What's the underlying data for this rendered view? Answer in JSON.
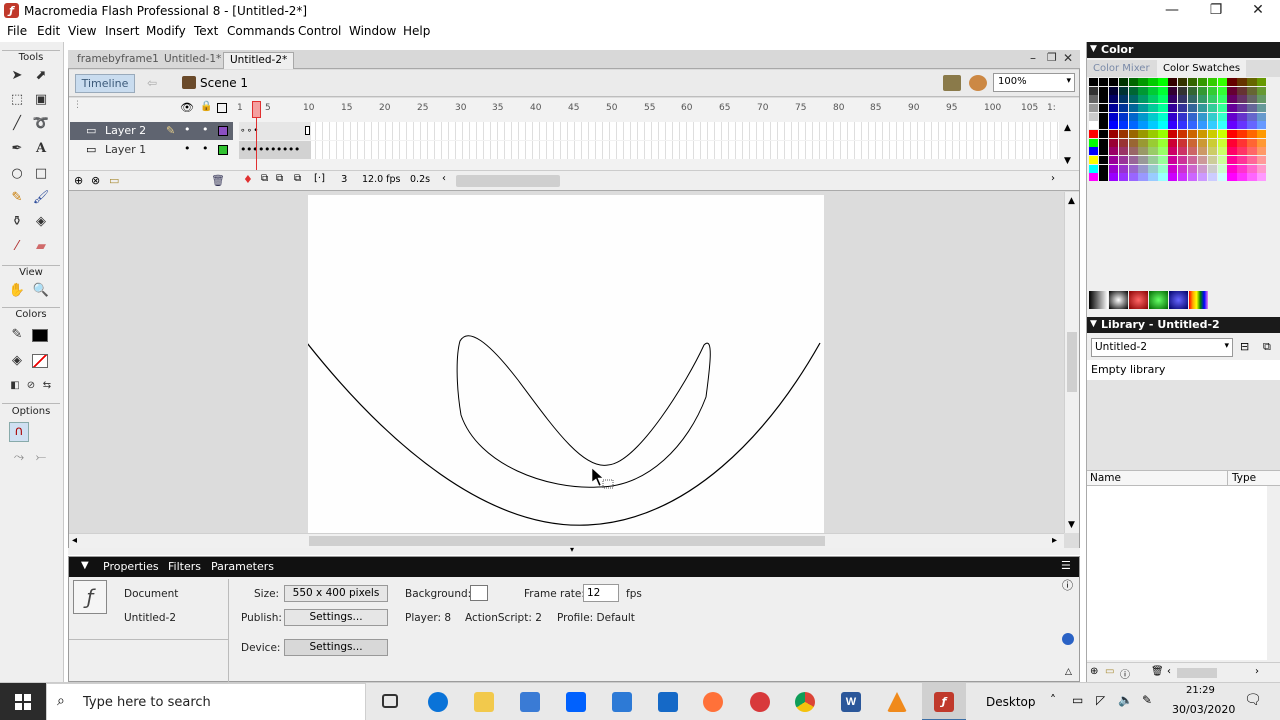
{
  "window": {
    "title": "Macromedia Flash Professional 8 - [Untitled-2*]"
  },
  "menu": [
    "File",
    "Edit",
    "View",
    "Insert",
    "Modify",
    "Text",
    "Commands",
    "Control",
    "Window",
    "Help"
  ],
  "tools": {
    "section_tools": "Tools",
    "section_view": "View",
    "section_colors": "Colors",
    "section_options": "Options",
    "icons": [
      "arrow-icon",
      "subselect-icon",
      "free-transform-icon",
      "fill-transform-icon",
      "line-icon",
      "lasso-icon",
      "pen-icon",
      "text-icon",
      "oval-icon",
      "rectangle-icon",
      "pencil-icon",
      "brush-icon",
      "ink-bottle-icon",
      "paint-bucket-icon",
      "eyedropper-icon",
      "eraser-icon"
    ]
  },
  "document": {
    "tabs": [
      "framebyframe1",
      "Untitled-1*",
      "Untitled-2*"
    ],
    "timeline_label": "Timeline",
    "scene": "Scene 1",
    "zoom": "100%"
  },
  "timeline": {
    "layers": [
      {
        "name": "Layer 2",
        "selected": true,
        "color": "#8b4fc1"
      },
      {
        "name": "Layer 1",
        "selected": false,
        "color": "#31c231"
      }
    ],
    "ruler": [
      "1",
      "5",
      "10",
      "15",
      "20",
      "25",
      "30",
      "35",
      "40",
      "45",
      "50",
      "55",
      "60",
      "65",
      "70",
      "75",
      "80",
      "85",
      "90",
      "95",
      "100",
      "105",
      "1:"
    ],
    "current_frame": "3",
    "fps": "12.0 fps",
    "elapsed": "0.2s"
  },
  "properties": {
    "tabs": [
      "Properties",
      "Filters",
      "Parameters"
    ],
    "type": "Document",
    "doc_name": "Untitled-2",
    "size_label": "Size:",
    "size_value": "550 x 400 pixels",
    "background_label": "Background:",
    "framerate_label": "Frame rate:",
    "framerate_value": "12",
    "fps_unit": "fps",
    "publish_label": "Publish:",
    "settings_btn": "Settings...",
    "player": "Player: 8",
    "actionscript": "ActionScript: 2",
    "profile": "Profile: Default",
    "device_label": "Device:"
  },
  "color_panel": {
    "title": "Color",
    "tabs": [
      "Color Mixer",
      "Color Swatches"
    ]
  },
  "library": {
    "title": "Library - Untitled-2",
    "selected": "Untitled-2",
    "empty_text": "Empty library",
    "col_name": "Name",
    "col_type": "Type"
  },
  "taskbar": {
    "search_placeholder": "Type here to search",
    "desktop": "Desktop",
    "time": "21:29",
    "date": "30/03/2020"
  },
  "colors": {
    "accent": "#c9dcef",
    "selected_layer": "#5f6470",
    "playhead": "#e03030"
  }
}
